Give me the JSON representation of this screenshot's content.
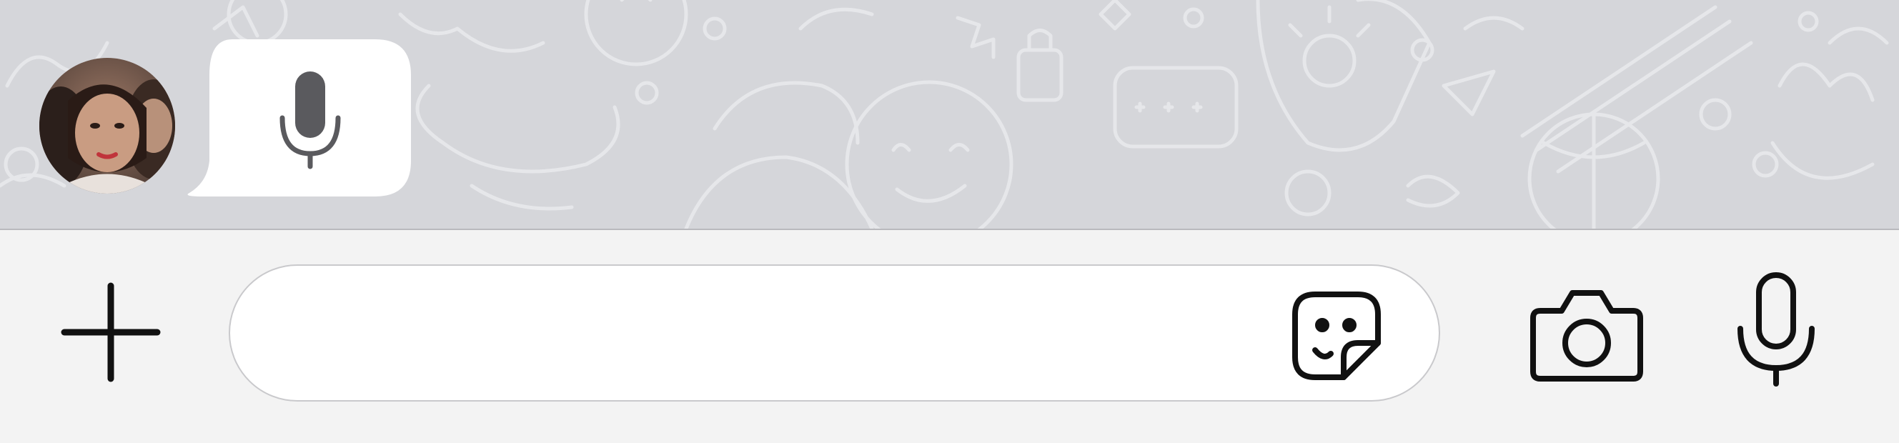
{
  "chat": {
    "voice_message": {
      "sender_avatar": "contact-photo",
      "icon": "microphone-icon"
    }
  },
  "composer": {
    "attach_icon": "plus-icon",
    "message_input": {
      "value": "",
      "placeholder": ""
    },
    "sticker_icon": "sticker-icon",
    "camera_icon": "camera-icon",
    "voice_icon": "microphone-icon"
  },
  "colors": {
    "chat_background": "#d5d6da",
    "composer_background": "#f3f3f3",
    "bubble": "#ffffff",
    "icon_dark": "#111111",
    "bubble_mic": "#5a5a5e"
  }
}
